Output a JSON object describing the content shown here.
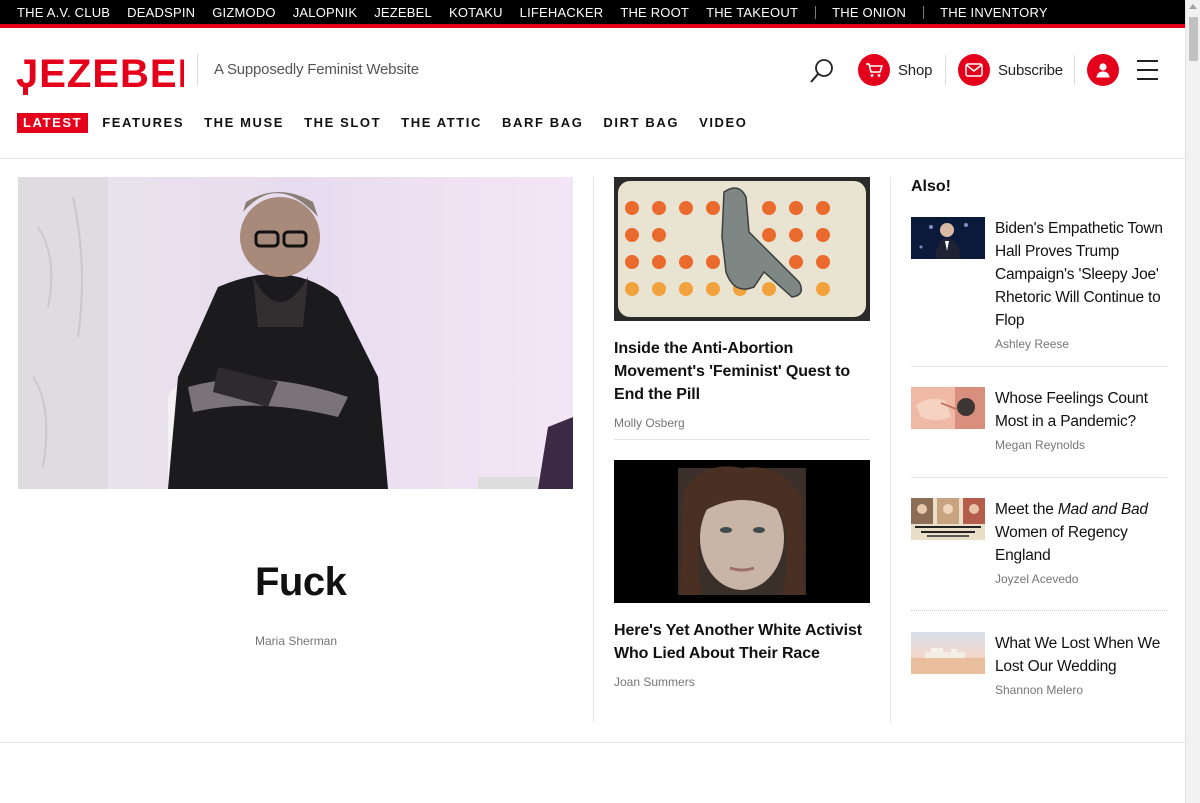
{
  "network": {
    "links": [
      "THE A.V. CLUB",
      "DEADSPIN",
      "GIZMODO",
      "JALOPNIK",
      "JEZEBEL",
      "KOTAKU",
      "LIFEHACKER",
      "THE ROOT",
      "THE TAKEOUT"
    ],
    "onion": "THE ONION",
    "inventory": "THE INVENTORY"
  },
  "header": {
    "logo_text": "JEZEBEL",
    "tagline": "A Supposedly Feminist Website",
    "shop_label": "Shop",
    "subscribe_label": "Subscribe",
    "icons": [
      "search-icon",
      "cart-icon",
      "mail-icon",
      "user-icon",
      "menu-icon"
    ]
  },
  "sections": [
    "LATEST",
    "FEATURES",
    "THE MUSE",
    "THE SLOT",
    "THE ATTIC",
    "BARF BAG",
    "DIRT BAG",
    "VIDEO"
  ],
  "lead": {
    "title": "Fuck",
    "author": "Maria Sherman"
  },
  "middle": [
    {
      "title": "Inside the Anti-Abortion Movement's 'Feminist' Quest to End the Pill",
      "author": "Molly Osberg"
    },
    {
      "title": "Here's Yet Another White Activist Who Lied About Their Race",
      "author": "Joan Summers"
    }
  ],
  "also": {
    "heading": "Also!",
    "items": [
      {
        "title": "Biden's Empathetic Town Hall Proves Trump Campaign's 'Sleepy Joe' Rhetoric Will Continue to Flop",
        "author": "Ashley Reese"
      },
      {
        "title": "Whose Feelings Count Most in a Pandemic?",
        "author": "Megan Reynolds"
      },
      {
        "title_pre": "Meet the ",
        "title_em": "Mad and Bad",
        "title_post": " Women of Regency England",
        "author": "Joyzel Acevedo"
      },
      {
        "title": "What We Lost When We Lost Our Wedding",
        "author": "Shannon Melero"
      }
    ]
  },
  "colors": {
    "brand": "#e4001b",
    "text": "#111111",
    "muted": "#767676"
  }
}
